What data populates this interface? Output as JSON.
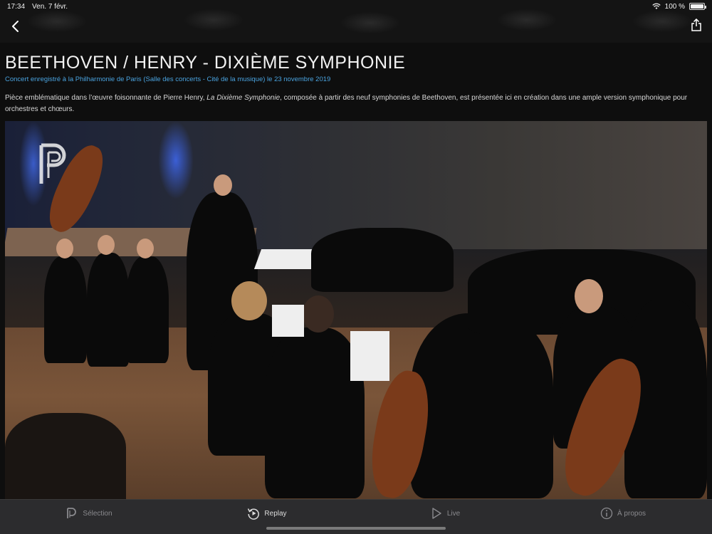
{
  "status": {
    "time": "17:34",
    "date": "Ven. 7 févr.",
    "battery_percent": "100 %",
    "battery_level": 1.0
  },
  "nav": {
    "back_icon": "chevron-left-icon",
    "share_icon": "share-icon"
  },
  "concert": {
    "title": "BEETHOVEN / HENRY - DIXIÈME SYMPHONIE",
    "subtitle": "Concert enregistré à la Philharmonie de Paris (Salle des concerts - Cité de la musique) le 23 novembre 2019",
    "description_before": "Pièce emblématique dans l’œuvre foisonnante de Pierre Henry, ",
    "description_italic": "La Dixième Symphonie",
    "description_after": ", composée à partir des neuf symphonies de Beethoven, est présentée ici en création dans une ample version symphonique pour orchestres et chœurs."
  },
  "video": {
    "watermark_icon": "philharmonie-logo-icon"
  },
  "tabs": [
    {
      "label": "Sélection",
      "icon": "philharmonie-p-icon",
      "active": false
    },
    {
      "label": "Replay",
      "icon": "replay-icon",
      "active": true
    },
    {
      "label": "Live",
      "icon": "play-icon",
      "active": false
    },
    {
      "label": "À propos",
      "icon": "info-icon",
      "active": false
    }
  ],
  "colors": {
    "accent_link": "#4aa3df",
    "background": "#0e0e0e",
    "tabbar": "#2c2c2e"
  }
}
